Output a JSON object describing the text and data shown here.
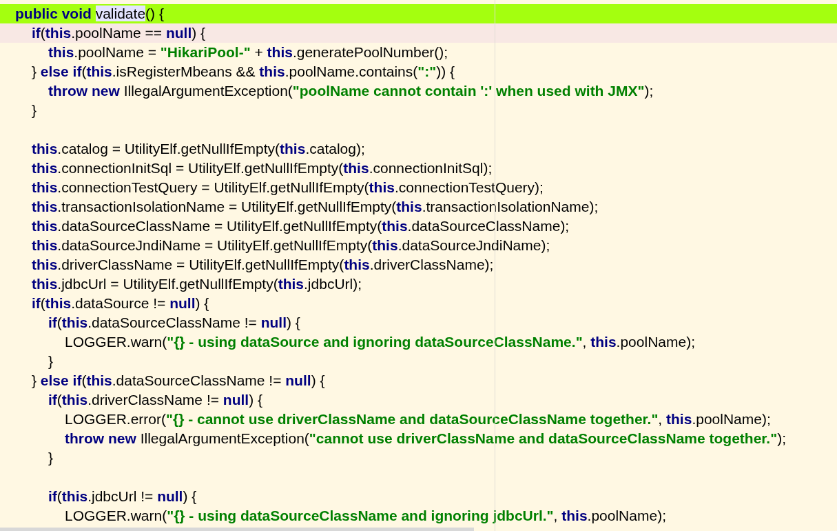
{
  "editor": {
    "lines": [
      {
        "kind": "code",
        "color": "#a4ff0f",
        "tokens": [
          {
            "kind": "keyword",
            "text": "public void "
          },
          {
            "kind": "usage",
            "text": "validate"
          },
          {
            "kind": "plain",
            "text": "() {"
          }
        ],
        "children": [
          {
            "kind": "code",
            "color": "#f8e8e4",
            "tokens": [
              {
                "kind": "keyword",
                "text": "if"
              },
              {
                "kind": "plain",
                "text": "("
              },
              {
                "kind": "keyword",
                "text": "this"
              },
              {
                "kind": "plain",
                "text": ".poolName == "
              },
              {
                "kind": "keyword",
                "text": "null"
              },
              {
                "kind": "plain",
                "text": ") {"
              }
            ],
            "children": [
              {
                "kind": "code",
                "tokens": [
                  {
                    "kind": "keyword",
                    "text": "this"
                  },
                  {
                    "kind": "plain",
                    "text": ".poolName = "
                  },
                  {
                    "kind": "string",
                    "text": "\"HikariPool-\""
                  },
                  {
                    "kind": "plain",
                    "text": " + "
                  },
                  {
                    "kind": "keyword",
                    "text": "this"
                  },
                  {
                    "kind": "plain",
                    "text": ".generatePoolNumber();"
                  }
                ]
              }
            ]
          },
          {
            "kind": "code",
            "tokens": [
              {
                "kind": "plain",
                "text": "} "
              },
              {
                "kind": "keyword",
                "text": "else if"
              },
              {
                "kind": "plain",
                "text": "("
              },
              {
                "kind": "keyword",
                "text": "this"
              },
              {
                "kind": "plain",
                "text": ".isRegisterMbeans && "
              },
              {
                "kind": "keyword",
                "text": "this"
              },
              {
                "kind": "plain",
                "text": ".poolName.contains("
              },
              {
                "kind": "string",
                "text": "\":\""
              },
              {
                "kind": "plain",
                "text": ")) {"
              }
            ],
            "children": [
              {
                "kind": "code",
                "tokens": [
                  {
                    "kind": "keyword",
                    "text": "throw new "
                  },
                  {
                    "kind": "plain",
                    "text": "IllegalArgumentException("
                  },
                  {
                    "kind": "string",
                    "text": "\"poolName cannot contain ':' when used with JMX\""
                  },
                  {
                    "kind": "plain",
                    "text": ");"
                  }
                ]
              }
            ]
          },
          {
            "kind": "code",
            "tokens": [
              {
                "kind": "plain",
                "text": "}"
              }
            ]
          },
          {
            "kind": "blank"
          },
          {
            "kind": "code",
            "tokens": [
              {
                "kind": "keyword",
                "text": "this"
              },
              {
                "kind": "plain",
                "text": ".catalog = UtilityElf.getNullIfEmpty("
              },
              {
                "kind": "keyword",
                "text": "this"
              },
              {
                "kind": "plain",
                "text": ".catalog);"
              }
            ]
          },
          {
            "kind": "code",
            "tokens": [
              {
                "kind": "keyword",
                "text": "this"
              },
              {
                "kind": "plain",
                "text": ".connectionInitSql = UtilityElf.getNullIfEmpty("
              },
              {
                "kind": "keyword",
                "text": "this"
              },
              {
                "kind": "plain",
                "text": ".connectionInitSql);"
              }
            ]
          },
          {
            "kind": "code",
            "tokens": [
              {
                "kind": "keyword",
                "text": "this"
              },
              {
                "kind": "plain",
                "text": ".connectionTestQuery = UtilityElf.getNullIfEmpty("
              },
              {
                "kind": "keyword",
                "text": "this"
              },
              {
                "kind": "plain",
                "text": ".connectionTestQuery);"
              }
            ]
          },
          {
            "kind": "code",
            "tokens": [
              {
                "kind": "keyword",
                "text": "this"
              },
              {
                "kind": "plain",
                "text": ".transactionIsolationName = UtilityElf.getNullIfEmpty("
              },
              {
                "kind": "keyword",
                "text": "this"
              },
              {
                "kind": "plain",
                "text": ".transactionIsolationName);"
              }
            ]
          },
          {
            "kind": "code",
            "tokens": [
              {
                "kind": "keyword",
                "text": "this"
              },
              {
                "kind": "plain",
                "text": ".dataSourceClassName = UtilityElf.getNullIfEmpty("
              },
              {
                "kind": "keyword",
                "text": "this"
              },
              {
                "kind": "plain",
                "text": ".dataSourceClassName);"
              }
            ]
          },
          {
            "kind": "code",
            "tokens": [
              {
                "kind": "keyword",
                "text": "this"
              },
              {
                "kind": "plain",
                "text": ".dataSourceJndiName = UtilityElf.getNullIfEmpty("
              },
              {
                "kind": "keyword",
                "text": "this"
              },
              {
                "kind": "plain",
                "text": ".dataSourceJndiName);"
              }
            ]
          },
          {
            "kind": "code",
            "tokens": [
              {
                "kind": "keyword",
                "text": "this"
              },
              {
                "kind": "plain",
                "text": ".driverClassName = UtilityElf.getNullIfEmpty("
              },
              {
                "kind": "keyword",
                "text": "this"
              },
              {
                "kind": "plain",
                "text": ".driverClassName);"
              }
            ]
          },
          {
            "kind": "code",
            "tokens": [
              {
                "kind": "keyword",
                "text": "this"
              },
              {
                "kind": "plain",
                "text": ".jdbcUrl = UtilityElf.getNullIfEmpty("
              },
              {
                "kind": "keyword",
                "text": "this"
              },
              {
                "kind": "plain",
                "text": ".jdbcUrl);"
              }
            ]
          },
          {
            "kind": "code",
            "tokens": [
              {
                "kind": "keyword",
                "text": "if"
              },
              {
                "kind": "plain",
                "text": "("
              },
              {
                "kind": "keyword",
                "text": "this"
              },
              {
                "kind": "plain",
                "text": ".dataSource != "
              },
              {
                "kind": "keyword",
                "text": "null"
              },
              {
                "kind": "plain",
                "text": ") {"
              }
            ],
            "children": [
              {
                "kind": "code",
                "tokens": [
                  {
                    "kind": "keyword",
                    "text": "if"
                  },
                  {
                    "kind": "plain",
                    "text": "("
                  },
                  {
                    "kind": "keyword",
                    "text": "this"
                  },
                  {
                    "kind": "plain",
                    "text": ".dataSourceClassName != "
                  },
                  {
                    "kind": "keyword",
                    "text": "null"
                  },
                  {
                    "kind": "plain",
                    "text": ") {"
                  }
                ],
                "children": [
                  {
                    "kind": "code",
                    "tokens": [
                      {
                        "kind": "plain",
                        "text": "LOGGER.warn("
                      },
                      {
                        "kind": "string",
                        "text": "\"{} - using dataSource and ignoring dataSourceClassName.\""
                      },
                      {
                        "kind": "plain",
                        "text": ", "
                      },
                      {
                        "kind": "keyword",
                        "text": "this"
                      },
                      {
                        "kind": "plain",
                        "text": ".poolName);"
                      }
                    ]
                  }
                ]
              },
              {
                "kind": "code",
                "tokens": [
                  {
                    "kind": "plain",
                    "text": "}"
                  }
                ]
              }
            ]
          },
          {
            "kind": "code",
            "tokens": [
              {
                "kind": "plain",
                "text": "} "
              },
              {
                "kind": "keyword",
                "text": "else if"
              },
              {
                "kind": "plain",
                "text": "("
              },
              {
                "kind": "keyword",
                "text": "this"
              },
              {
                "kind": "plain",
                "text": ".dataSourceClassName != "
              },
              {
                "kind": "keyword",
                "text": "null"
              },
              {
                "kind": "plain",
                "text": ") {"
              }
            ],
            "children": [
              {
                "kind": "code",
                "tokens": [
                  {
                    "kind": "keyword",
                    "text": "if"
                  },
                  {
                    "kind": "plain",
                    "text": "("
                  },
                  {
                    "kind": "keyword",
                    "text": "this"
                  },
                  {
                    "kind": "plain",
                    "text": ".driverClassName != "
                  },
                  {
                    "kind": "keyword",
                    "text": "null"
                  },
                  {
                    "kind": "plain",
                    "text": ") {"
                  }
                ],
                "children": [
                  {
                    "kind": "code",
                    "tokens": [
                      {
                        "kind": "plain",
                        "text": "LOGGER.error("
                      },
                      {
                        "kind": "string",
                        "text": "\"{} - cannot use driverClassName and dataSourceClassName together.\""
                      },
                      {
                        "kind": "plain",
                        "text": ", "
                      },
                      {
                        "kind": "keyword",
                        "text": "this"
                      },
                      {
                        "kind": "plain",
                        "text": ".poolName);"
                      }
                    ]
                  },
                  {
                    "kind": "code",
                    "tokens": [
                      {
                        "kind": "keyword",
                        "text": "throw new "
                      },
                      {
                        "kind": "plain",
                        "text": "IllegalArgumentException("
                      },
                      {
                        "kind": "string",
                        "text": "\"cannot use driverClassName and dataSourceClassName together.\""
                      },
                      {
                        "kind": "plain",
                        "text": ");"
                      }
                    ]
                  }
                ]
              },
              {
                "kind": "code",
                "tokens": [
                  {
                    "kind": "plain",
                    "text": "}"
                  }
                ]
              },
              {
                "kind": "blank"
              },
              {
                "kind": "code",
                "tokens": [
                  {
                    "kind": "keyword",
                    "text": "if"
                  },
                  {
                    "kind": "plain",
                    "text": "("
                  },
                  {
                    "kind": "keyword",
                    "text": "this"
                  },
                  {
                    "kind": "plain",
                    "text": ".jdbcUrl != "
                  },
                  {
                    "kind": "keyword",
                    "text": "null"
                  },
                  {
                    "kind": "plain",
                    "text": ") {"
                  }
                ],
                "children": [
                  {
                    "kind": "code",
                    "tokens": [
                      {
                        "kind": "plain",
                        "text": "LOGGER.warn("
                      },
                      {
                        "kind": "string",
                        "text": "\"{} - using dataSourceClassName and ignoring jdbcUrl.\""
                      },
                      {
                        "kind": "plain",
                        "text": ", "
                      },
                      {
                        "kind": "keyword",
                        "text": "this"
                      },
                      {
                        "kind": "plain",
                        "text": ".poolName);"
                      }
                    ]
                  }
                ]
              }
            ]
          }
        ]
      }
    ]
  }
}
